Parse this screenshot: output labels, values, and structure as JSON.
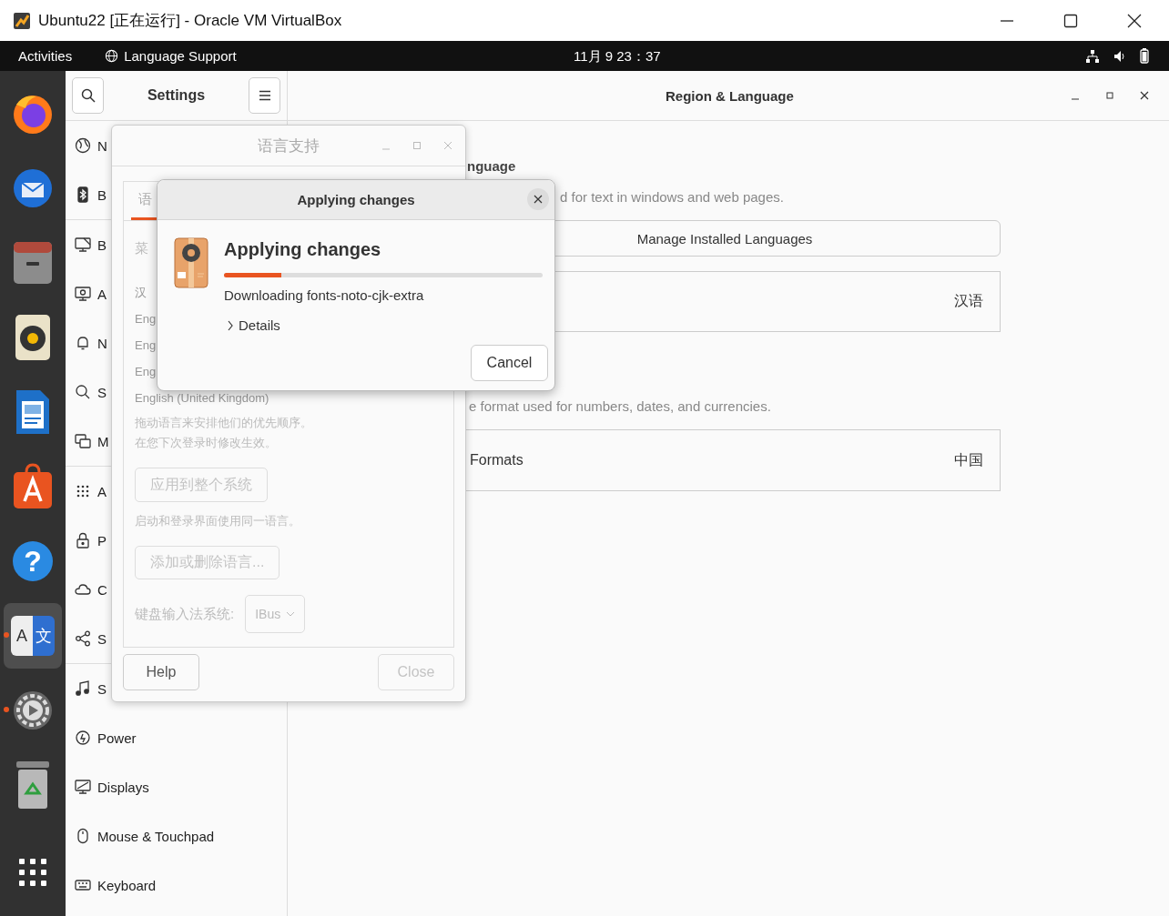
{
  "vm_window": {
    "title": "Ubuntu22 [正在运行] - Oracle VM VirtualBox"
  },
  "top_bar": {
    "activities": "Activities",
    "app_menu": "Language Support",
    "clock": "11月 9 23：37"
  },
  "dock": [
    {
      "kind": "browser",
      "selected": false,
      "running": false
    },
    {
      "kind": "mail",
      "selected": false,
      "running": false
    },
    {
      "kind": "files",
      "selected": false,
      "running": false
    },
    {
      "kind": "music",
      "selected": false,
      "running": false
    },
    {
      "kind": "writer",
      "selected": false,
      "running": false
    },
    {
      "kind": "store",
      "selected": false,
      "running": false
    },
    {
      "kind": "help",
      "glyph": "?",
      "selected": false,
      "running": false
    },
    {
      "kind": "language",
      "glyphs": [
        "A",
        "文"
      ],
      "selected": true,
      "running": true
    },
    {
      "kind": "settings",
      "selected": false,
      "running": true
    },
    {
      "kind": "trash",
      "selected": false,
      "running": false
    },
    {
      "kind": "apps",
      "selected": false,
      "running": false
    }
  ],
  "settings": {
    "sidebar": {
      "title": "Settings",
      "groups": [
        [
          {
            "kind": "network",
            "label": "N"
          },
          {
            "kind": "bluetooth",
            "label": "B"
          }
        ],
        [
          {
            "kind": "background",
            "label": "B"
          },
          {
            "kind": "appearance",
            "label": "A"
          },
          {
            "kind": "notifications",
            "label": "N"
          },
          {
            "kind": "search",
            "label": "S"
          },
          {
            "kind": "multitasking",
            "label": "M"
          }
        ],
        [
          {
            "kind": "apps",
            "label": "A"
          },
          {
            "kind": "privacy",
            "label": "P"
          },
          {
            "kind": "cloud",
            "label": "C"
          },
          {
            "kind": "sharing",
            "label": "S"
          }
        ],
        [
          {
            "kind": "sound",
            "label": "S"
          },
          {
            "kind": "power",
            "label": "Power"
          },
          {
            "kind": "displays",
            "label": "Displays"
          },
          {
            "kind": "mouse",
            "label": "Mouse & Touchpad"
          },
          {
            "kind": "keyboard",
            "label": "Keyboard"
          }
        ]
      ]
    },
    "panel": {
      "title": "Region & Language",
      "language_heading": "nguage",
      "language_description": "d for text in windows and web pages.",
      "manage_button": "Manage Installed Languages",
      "language_value": "汉语",
      "formats_description": "e format used for numbers, dates, and currencies.",
      "formats_label": "Formats",
      "formats_value": "中国"
    }
  },
  "language_support": {
    "title": "语言支持",
    "tabs": [
      {
        "label": "语",
        "selected": true
      }
    ],
    "menu_label": "菜",
    "languages": [
      "汉",
      "Eng",
      "Eng",
      "Eng",
      "English (United Kingdom)"
    ],
    "hints": [
      "拖动语言来安排他们的优先顺序。",
      "在您下次登录时修改生效。"
    ],
    "apply_button": {
      "label": "应用到整个系统",
      "disabled": true
    },
    "login_hint": "启动和登录界面使用同一语言。",
    "add_button": {
      "label": "添加或删除语言...",
      "disabled": true
    },
    "input_label": "键盘输入法系统:",
    "input_select": {
      "value": "IBus",
      "disabled": true
    },
    "help_button": {
      "label": "Help",
      "disabled": false
    },
    "close_button": {
      "label": "Close",
      "disabled": true
    }
  },
  "dialog": {
    "window_title": "Applying changes",
    "heading": "Applying changes",
    "progress": {
      "level": 0.18
    },
    "status": "Downloading fonts-noto-cjk-extra",
    "details": {
      "label": "Details",
      "expanded": false
    },
    "cancel": "Cancel"
  }
}
